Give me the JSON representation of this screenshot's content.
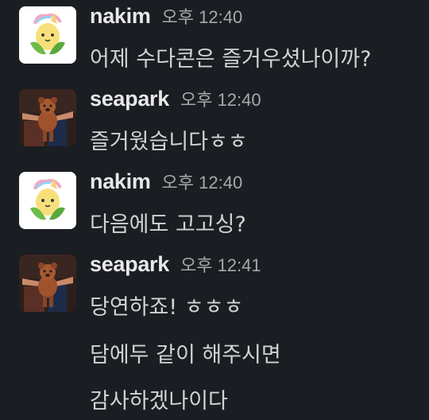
{
  "messages": [
    {
      "user": "nakim",
      "avatar_icon": "corn-unicorn-avatar-icon",
      "time": "오후 12:40",
      "lines": [
        "어제 수다콘은 즐거우셨나이까?"
      ]
    },
    {
      "user": "seapark",
      "avatar_icon": "teddy-bear-avatar-icon",
      "time": "오후 12:40",
      "lines": [
        "즐거웠습니다ㅎㅎ"
      ]
    },
    {
      "user": "nakim",
      "avatar_icon": "corn-unicorn-avatar-icon",
      "time": "오후 12:40",
      "lines": [
        "다음에도 고고싱?"
      ]
    },
    {
      "user": "seapark",
      "avatar_icon": "teddy-bear-avatar-icon",
      "time": "오후 12:41",
      "lines": [
        "당연하죠! ㅎㅎㅎ",
        "담에두 같이 해주시면",
        "감사하겠나이다"
      ]
    }
  ],
  "colors": {
    "background": "#1a1d21",
    "username": "#e8e8e8",
    "timestamp": "#a6a8ab",
    "message_text": "#d1d2d3"
  }
}
